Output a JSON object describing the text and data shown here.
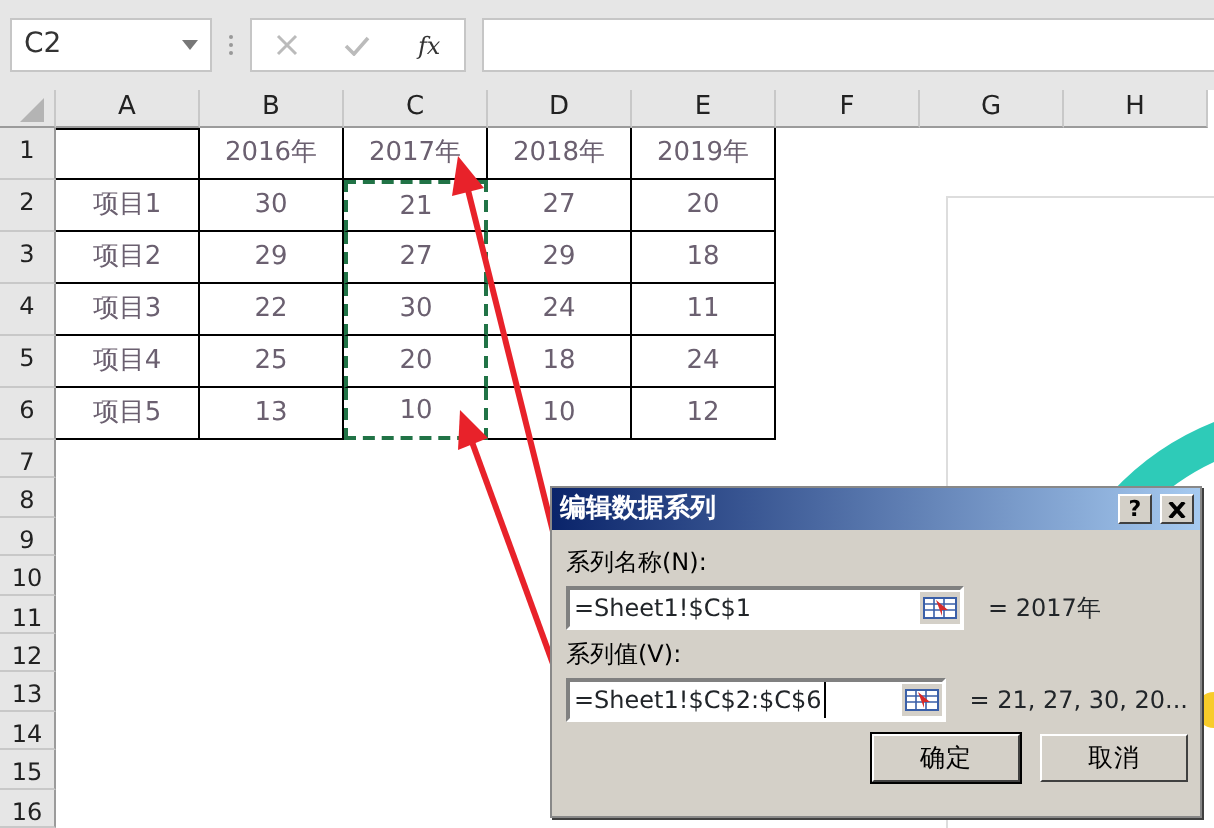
{
  "name_box": {
    "value": "C2"
  },
  "formula_bar": {
    "function_label": "fx"
  },
  "columns": [
    "A",
    "B",
    "C",
    "D",
    "E",
    "F",
    "G",
    "H"
  ],
  "row_numbers": [
    "1",
    "2",
    "3",
    "4",
    "5",
    "6",
    "7",
    "8",
    "9",
    "10",
    "11",
    "12",
    "13",
    "14",
    "15",
    "16"
  ],
  "header_row": [
    {
      "text": "2016年",
      "marquee": false
    },
    {
      "text": "2017年",
      "marquee": false
    },
    {
      "text": "2018年",
      "marquee": false
    },
    {
      "text": "2019年",
      "marquee": false
    }
  ],
  "data_rows": [
    {
      "label": "项目1",
      "values": [
        {
          "text": "30",
          "marquee": false
        },
        {
          "text": "21",
          "marquee": true
        },
        {
          "text": "27",
          "marquee": false
        },
        {
          "text": "20",
          "marquee": false
        }
      ]
    },
    {
      "label": "项目2",
      "values": [
        {
          "text": "29",
          "marquee": false
        },
        {
          "text": "27",
          "marquee": true
        },
        {
          "text": "29",
          "marquee": false
        },
        {
          "text": "18",
          "marquee": false
        }
      ]
    },
    {
      "label": "项目3",
      "values": [
        {
          "text": "22",
          "marquee": false
        },
        {
          "text": "30",
          "marquee": true
        },
        {
          "text": "24",
          "marquee": false
        },
        {
          "text": "11",
          "marquee": false
        }
      ]
    },
    {
      "label": "项目4",
      "values": [
        {
          "text": "25",
          "marquee": false
        },
        {
          "text": "20",
          "marquee": true
        },
        {
          "text": "18",
          "marquee": false
        },
        {
          "text": "24",
          "marquee": false
        }
      ]
    },
    {
      "label": "项目5",
      "values": [
        {
          "text": "13",
          "marquee": false
        },
        {
          "text": "10",
          "marquee": true
        },
        {
          "text": "10",
          "marquee": false
        },
        {
          "text": "12",
          "marquee": false
        }
      ]
    }
  ],
  "dialog": {
    "title": "编辑数据系列",
    "help": "?",
    "fields": [
      {
        "label": "系列名称(N):",
        "value": "=Sheet1!$C$1",
        "result": "= 2017年",
        "focused": false
      },
      {
        "label": "系列值(V):",
        "value": "=Sheet1!$C$2:$C$6",
        "result": "= 21, 27, 30, 20...",
        "focused": true
      }
    ],
    "buttons": [
      {
        "label": "确定",
        "default": true
      },
      {
        "label": "取消",
        "default": false
      }
    ]
  }
}
